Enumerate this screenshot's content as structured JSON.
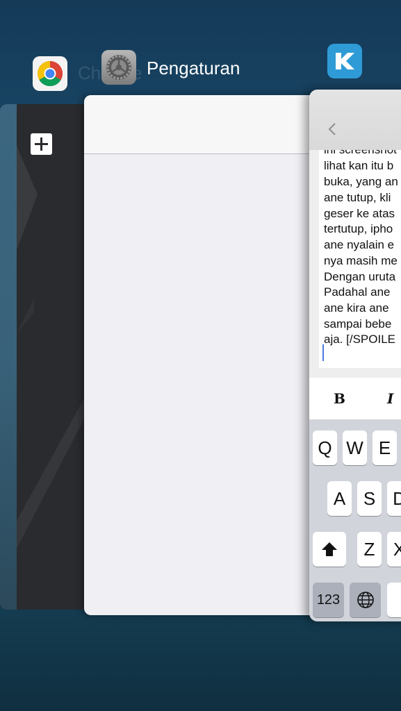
{
  "switcher": {
    "chrome_label": "Chrome",
    "settings_label": "Pengaturan",
    "kaskus_icon": "kaskus-k-icon"
  },
  "chrome_card": {
    "new_tab_icon": "plus-icon"
  },
  "kaskus_card": {
    "editor_lines": [
      "ini screenshot",
      "lihat kan itu b",
      "buka, yang an",
      "ane tutup, kli",
      "geser ke atas",
      "tertutup, ipho",
      "ane nyalain e",
      "nya masih me",
      "Dengan uruta",
      "Padahal ane",
      "ane kira ane",
      "sampai bebe",
      "aja.  [/SPOILE"
    ],
    "format_bold": "B",
    "format_italic": "I",
    "keyboard": {
      "row1": [
        "Q",
        "W",
        "E"
      ],
      "row2": [
        "A",
        "S",
        "D"
      ],
      "row3": [
        "Z",
        "X"
      ],
      "numbers_key": "123"
    }
  },
  "colors": {
    "kaskus_blue": "#2f9bd6",
    "chrome_dark": "#2a2b2e"
  }
}
